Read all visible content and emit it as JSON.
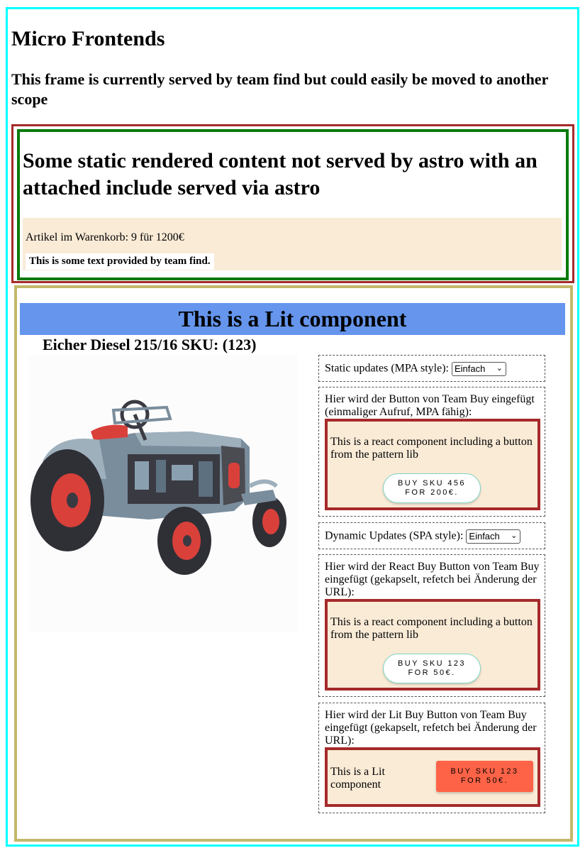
{
  "header": {
    "title": "Micro Frontends",
    "subtitle": "This frame is currently served by team find but could easily be moved to another scope"
  },
  "static_section": {
    "heading": "Some static rendered content not served by astro with an attached include served via astro",
    "cart_text": "Artikel im Warenkorb: 9 für 1200€",
    "find_text": "This is some text provided by team find."
  },
  "lit_component": {
    "banner": "This is a Lit component",
    "product_title": "Eicher Diesel 215/16 SKU: (123)",
    "static_updates": {
      "label": "Static updates (MPA style):",
      "selected": "Einfach"
    },
    "team_buy_block": {
      "label": "Hier wird der Button von Team Buy eingefügt (einmaliger Aufruf, MPA fähig):",
      "react_text": "This is a react component including a button from the pattern lib",
      "button_line1": "BUY SKU 456",
      "button_line2": "FOR 200€."
    },
    "dynamic_updates": {
      "label": "Dynamic Updates (SPA style):",
      "selected": "Einfach"
    },
    "react_buy_block": {
      "label": "Hier wird der React Buy Button von Team Buy eingefügt (gekapselt, refetch bei Änderung der URL):",
      "react_text": "This is a react component including a button from the pattern lib",
      "button_line1": "BUY SKU 123",
      "button_line2": "FOR 50€."
    },
    "lit_buy_block": {
      "label": "Hier wird der Lit Buy Button von Team Buy eingefügt (gekapselt, refetch bei Änderung der URL):",
      "lit_text": "This is a Lit component",
      "button_line1": "BUY SKU 123",
      "button_line2": "FOR 50€."
    }
  },
  "colors": {
    "frame_border": "#00ffff",
    "static_border": "#a52a2a",
    "green_border": "#0a7a0a",
    "lit_border": "#c2b86a",
    "banner_bg": "#6595ec",
    "cart_bg": "#faebd7",
    "lit_button_bg": "#ff6347"
  },
  "icons": {
    "select_chevron": "chevron-down-icon",
    "product_image": "tractor-image"
  }
}
